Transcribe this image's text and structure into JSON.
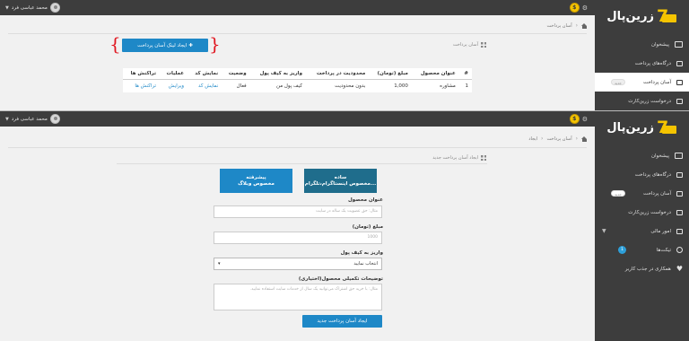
{
  "brand": {
    "name": "زرین‌پال"
  },
  "user": {
    "name": "محمد عباسی فرد"
  },
  "coin": {
    "label": "$"
  },
  "sidebar1": {
    "items": [
      {
        "label": "پیشخوان",
        "icon": "monitor-icon"
      },
      {
        "label": "درگاه‌های پرداخت",
        "icon": "card-icon"
      },
      {
        "label": "آسان پرداخت",
        "badge": "جدید",
        "icon": "easy-pay-icon",
        "active": true
      },
      {
        "label": "درخواست زرین‌کارت",
        "icon": "zarincard-icon"
      }
    ]
  },
  "sidebar2": {
    "items": [
      {
        "label": "پیشخوان",
        "icon": "monitor-icon"
      },
      {
        "label": "درگاه‌های پرداخت",
        "icon": "card-icon"
      },
      {
        "label": "آسان پرداخت",
        "badge": "جدید",
        "icon": "easy-pay-icon",
        "active": true
      },
      {
        "label": "درخواست زرین‌کارت",
        "icon": "zarincard-icon"
      },
      {
        "label": "امور مالی",
        "icon": "finance-icon"
      },
      {
        "label": "تیکت‌ها",
        "count": "1",
        "icon": "ticket-icon"
      },
      {
        "label": "همکاری در جذب کاربر",
        "icon": "heart-icon"
      }
    ]
  },
  "page1": {
    "breadcrumb": [
      "آسان پرداخت"
    ],
    "panel_title": "آسان پرداخت",
    "create_button": "ایجاد لینک آسان پرداخت",
    "table": {
      "headers": [
        "#",
        "عنوان محصول",
        "مبلغ (تومان)",
        "محدودیت در پرداخت",
        "واریز به کیف پول",
        "وضعیت",
        "نمایش کد",
        "عملیات",
        "تراکنش ها"
      ],
      "rows": [
        [
          "1",
          "مشاوره",
          "1,000",
          "بدون محدودیت",
          "کیف پول من",
          "فعال",
          "نمایش کد",
          "ویرایش",
          "تراکنش ها"
        ]
      ]
    }
  },
  "page2": {
    "breadcrumb": [
      "آسان پرداخت",
      "ایجاد"
    ],
    "panel_title": "ایجاد آسان پرداخت جدید",
    "choice_simple": {
      "line1": "ساده",
      "line2": "مخصوص اینستاگرام،تلگرام..."
    },
    "choice_advanced": {
      "line1": "پیشرفته",
      "line2": "مخصوص وبلاگ"
    },
    "fields": {
      "title_label": "عنوان محصول",
      "title_placeholder": "مثال: حق عضویت یک ساله در سایت",
      "amount_label": "مبلغ (تومان)",
      "amount_placeholder": "1000",
      "wallet_label": "واریز به کیف پول",
      "wallet_value": "انتخاب نمایید",
      "desc_label": "توضیحات تکمیلی محصول(اختیاری)",
      "desc_placeholder": "مثال: با خرید حق اشتراک می‌توانید یک سال از خدمات سایت استفاده نمایید."
    },
    "submit": "ایجاد آسان پرداخت جدید"
  },
  "colors": {
    "accent": "#1e88c7",
    "simple": "#1f6d8c",
    "sidebar": "#3d3d3d",
    "coin": "#f5c400",
    "brace": "#e0151f"
  }
}
